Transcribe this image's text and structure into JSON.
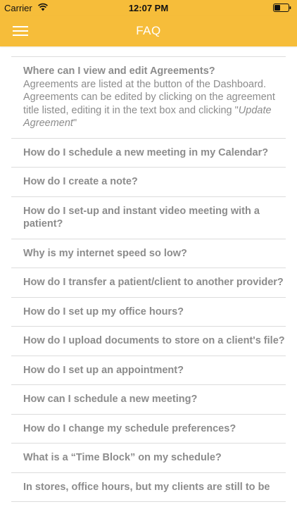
{
  "status_bar": {
    "carrier": "Carrier",
    "time": "12:07 PM",
    "wifi_icon": "wifi-icon",
    "battery_icon": "battery-icon"
  },
  "nav": {
    "title": "FAQ",
    "menu_icon": "hamburger-menu-icon",
    "background_color": "#f6bd3a"
  },
  "faq": {
    "expanded": {
      "question": "Where can I view and edit Agreements?",
      "answer_prefix": "Agreements are listed at the button of the Dashboard. Agreements can be edited by clicking on the agreement title listed, editing it in the text box and clicking \"",
      "answer_emphasis": "Update Agreement",
      "answer_suffix": "\""
    },
    "items": [
      {
        "question": "How do I schedule a new meeting in my Calendar?"
      },
      {
        "question": "How do I create a note?"
      },
      {
        "question": "How do I set-up and instant video meeting with a patient?"
      },
      {
        "question": "Why is my internet speed so low?"
      },
      {
        "question": "How do I transfer a patient/client to another provider?"
      },
      {
        "question": "How do I set up my office hours?"
      },
      {
        "question": "How do I upload documents to store on a client's file?"
      },
      {
        "question": "How do I set up an appointment?"
      },
      {
        "question": "How can I schedule a new meeting?"
      },
      {
        "question": "How do I change my schedule preferences?"
      },
      {
        "question": "What is a “Time Block” on my schedule?"
      },
      {
        "question": "In stores, office hours, but my clients are still to be"
      }
    ]
  }
}
